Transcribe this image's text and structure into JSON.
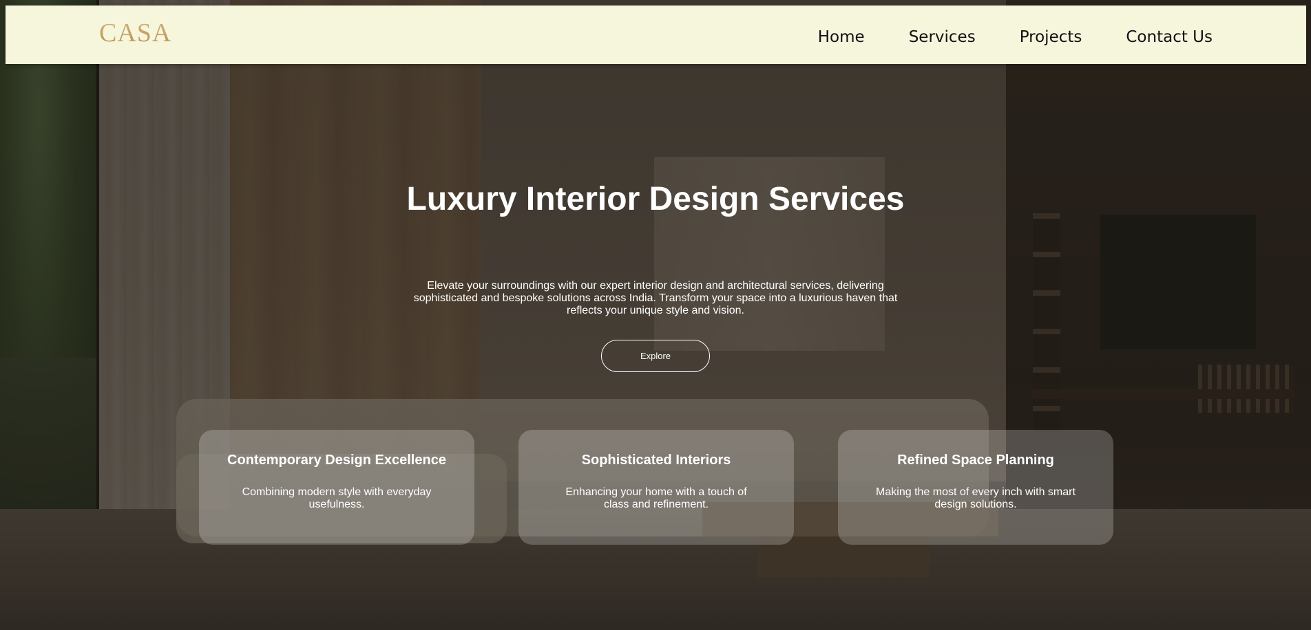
{
  "nav": {
    "logo": "CASA",
    "links": [
      "Home",
      "Services",
      "Projects",
      "Contact Us"
    ]
  },
  "hero": {
    "title": "Luxury Interior Design Services",
    "description": "Elevate your surroundings with our expert interior design and architectural services, delivering sophisticated and bespoke solutions across India. Transform your space into a luxurious haven that reflects your unique style and vision.",
    "button_label": "Explore"
  },
  "cards": [
    {
      "title": "Contemporary Design Excellence",
      "description": "Combining modern style with everyday usefulness."
    },
    {
      "title": "Sophisticated Interiors",
      "description": "Enhancing your home with a touch of class and refinement."
    },
    {
      "title": "Refined Space Planning",
      "description": "Making the most of every inch with smart design solutions."
    }
  ],
  "colors": {
    "navbar_bg": "#f6f6dd",
    "logo_gold": "#c4a062",
    "hero_text": "#ffffff"
  }
}
